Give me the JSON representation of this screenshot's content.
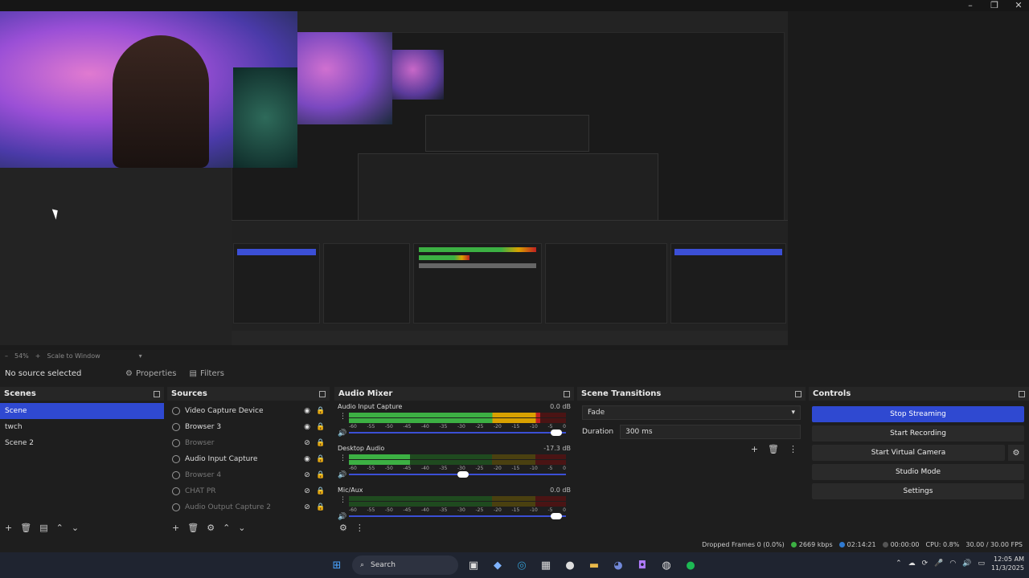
{
  "zoom": {
    "percent": "54%",
    "mode": "Scale to Window"
  },
  "context": {
    "no_source": "No source selected",
    "properties": "Properties",
    "filters": "Filters"
  },
  "scenes": {
    "title": "Scenes",
    "items": [
      "Scene",
      "twch",
      "Scene 2"
    ]
  },
  "sources": {
    "title": "Sources",
    "items": [
      {
        "label": "Video Capture Device",
        "visible": true
      },
      {
        "label": "Browser 3",
        "visible": true
      },
      {
        "label": "Browser",
        "visible": false
      },
      {
        "label": "Audio Input Capture",
        "visible": true
      },
      {
        "label": "Browser 4",
        "visible": false
      },
      {
        "label": "CHAT PR",
        "visible": false
      },
      {
        "label": "Audio Output Capture 2",
        "visible": false
      }
    ]
  },
  "mixer": {
    "title": "Audio Mixer",
    "scale": [
      "-60",
      "-55",
      "-50",
      "-45",
      "-40",
      "-35",
      "-30",
      "-25",
      "-20",
      "-15",
      "-10",
      "-5",
      "0"
    ],
    "channels": [
      {
        "name": "Audio Input Capture",
        "db": "0.0 dB",
        "level": 0.88,
        "volume": 0.98
      },
      {
        "name": "Desktop Audio",
        "db": "-17.3 dB",
        "level": 0.28,
        "volume": 0.55
      },
      {
        "name": "Mic/Aux",
        "db": "0.0 dB",
        "level": 0.0,
        "volume": 0.98
      }
    ]
  },
  "transitions": {
    "title": "Scene Transitions",
    "selected": "Fade",
    "duration_label": "Duration",
    "duration_value": "300 ms"
  },
  "controls": {
    "title": "Controls",
    "stop_streaming": "Stop Streaming",
    "start_recording": "Start Recording",
    "start_virtual_camera": "Start Virtual Camera",
    "studio_mode": "Studio Mode",
    "settings": "Settings"
  },
  "status": {
    "dropped": "Dropped Frames 0 (0.0%)",
    "bitrate": "2669 kbps",
    "live_time": "02:14:21",
    "rec_time": "00:00:00",
    "cpu": "CPU: 0.8%",
    "fps": "30.00 / 30.00 FPS"
  },
  "taskbar": {
    "search": "Search",
    "time": "12:05 AM",
    "date": "11/3/2025"
  }
}
